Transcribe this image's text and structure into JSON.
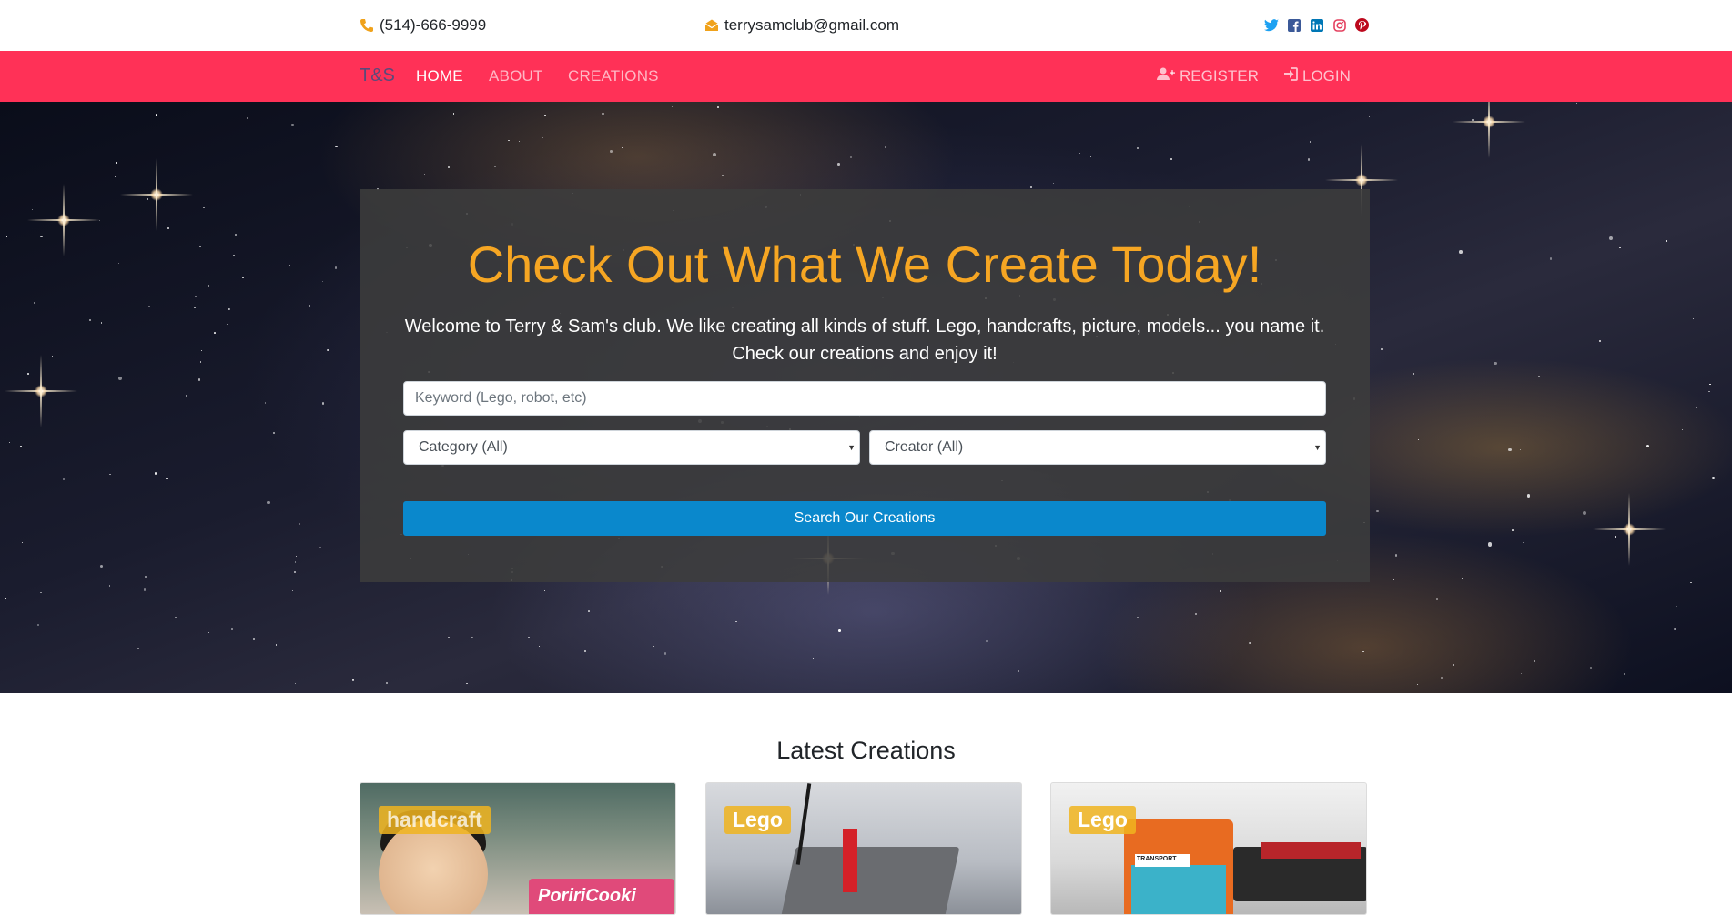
{
  "contact": {
    "phone": "(514)-666-9999",
    "email": "terrysamclub@gmail.com"
  },
  "socials": [
    {
      "name": "twitter-icon",
      "color": "#1da1f2"
    },
    {
      "name": "facebook-icon",
      "color": "#3b5998"
    },
    {
      "name": "linkedin-icon",
      "color": "#0077b5"
    },
    {
      "name": "instagram-icon",
      "color": "#e4405f"
    },
    {
      "name": "pinterest-icon",
      "color": "#bd081c"
    }
  ],
  "nav": {
    "brand": "T&S",
    "home": "HOME",
    "about": "ABOUT",
    "creations": "CREATIONS",
    "register": "REGISTER",
    "login": "LOGIN",
    "bar_color": "#ff3157"
  },
  "hero": {
    "title": "Check Out What We Create Today!",
    "text": "Welcome to Terry & Sam's club. We like creating all kinds of stuff. Lego, handcrafts, picture, models... you name it. Check our creations and enjoy it!",
    "keyword_placeholder": "Keyword (Lego, robot, etc)",
    "category_selected": "Category (All)",
    "creator_selected": "Creator (All)",
    "search_button": "Search Our Creations",
    "title_color": "#f6a623",
    "button_color": "#0a88cc"
  },
  "latest": {
    "title": "Latest Creations",
    "cards": [
      {
        "badge": "handcraft",
        "box_text": "PoririCooki"
      },
      {
        "badge": "Lego"
      },
      {
        "badge": "Lego",
        "sign_text": "TRANSPORT"
      }
    ]
  }
}
